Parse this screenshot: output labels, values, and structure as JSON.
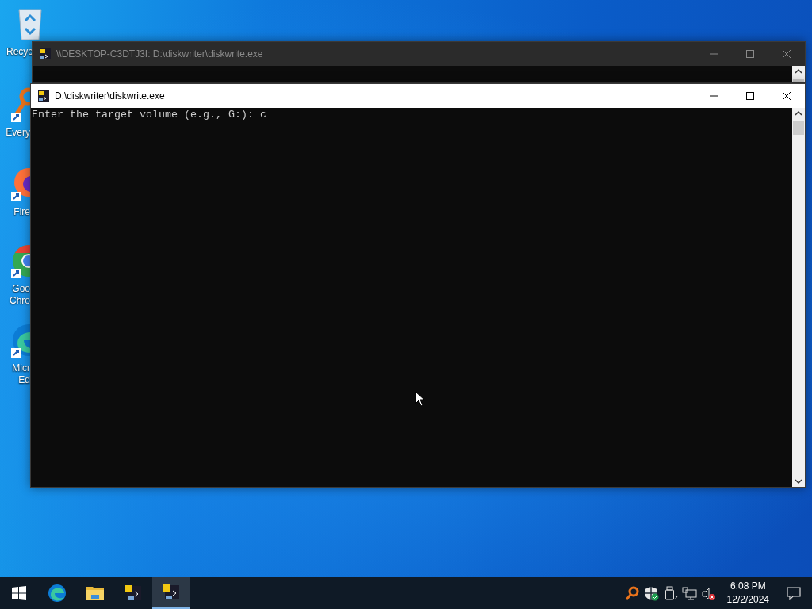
{
  "desktop_icons": [
    {
      "kind": "recycle",
      "lines": [
        "Recyc"
      ]
    },
    {
      "kind": "everything",
      "lines": [
        "Every"
      ]
    },
    {
      "kind": "firefox",
      "lines": [
        "Fire"
      ]
    },
    {
      "kind": "chrome",
      "lines": [
        "Goo",
        "Chro"
      ]
    },
    {
      "kind": "edge",
      "lines": [
        "Micr",
        "Ed"
      ]
    }
  ],
  "windows": [
    {
      "title": "\\\\DESKTOP-C3DTJ3I: D:\\diskwriter\\diskwrite.exe",
      "active": false
    },
    {
      "title": "D:\\diskwriter\\diskwrite.exe",
      "active": true,
      "lines": [
        "Enter the target volume (e.g., G:): c"
      ]
    }
  ],
  "taskbar": {
    "buttons": [
      {
        "kind": "edge",
        "selected": false
      },
      {
        "kind": "explorer",
        "selected": false
      },
      {
        "kind": "console",
        "selected": false
      },
      {
        "kind": "console",
        "selected": true
      }
    ],
    "clock": {
      "time": "6:08 PM",
      "date": "12/2/2024"
    }
  }
}
